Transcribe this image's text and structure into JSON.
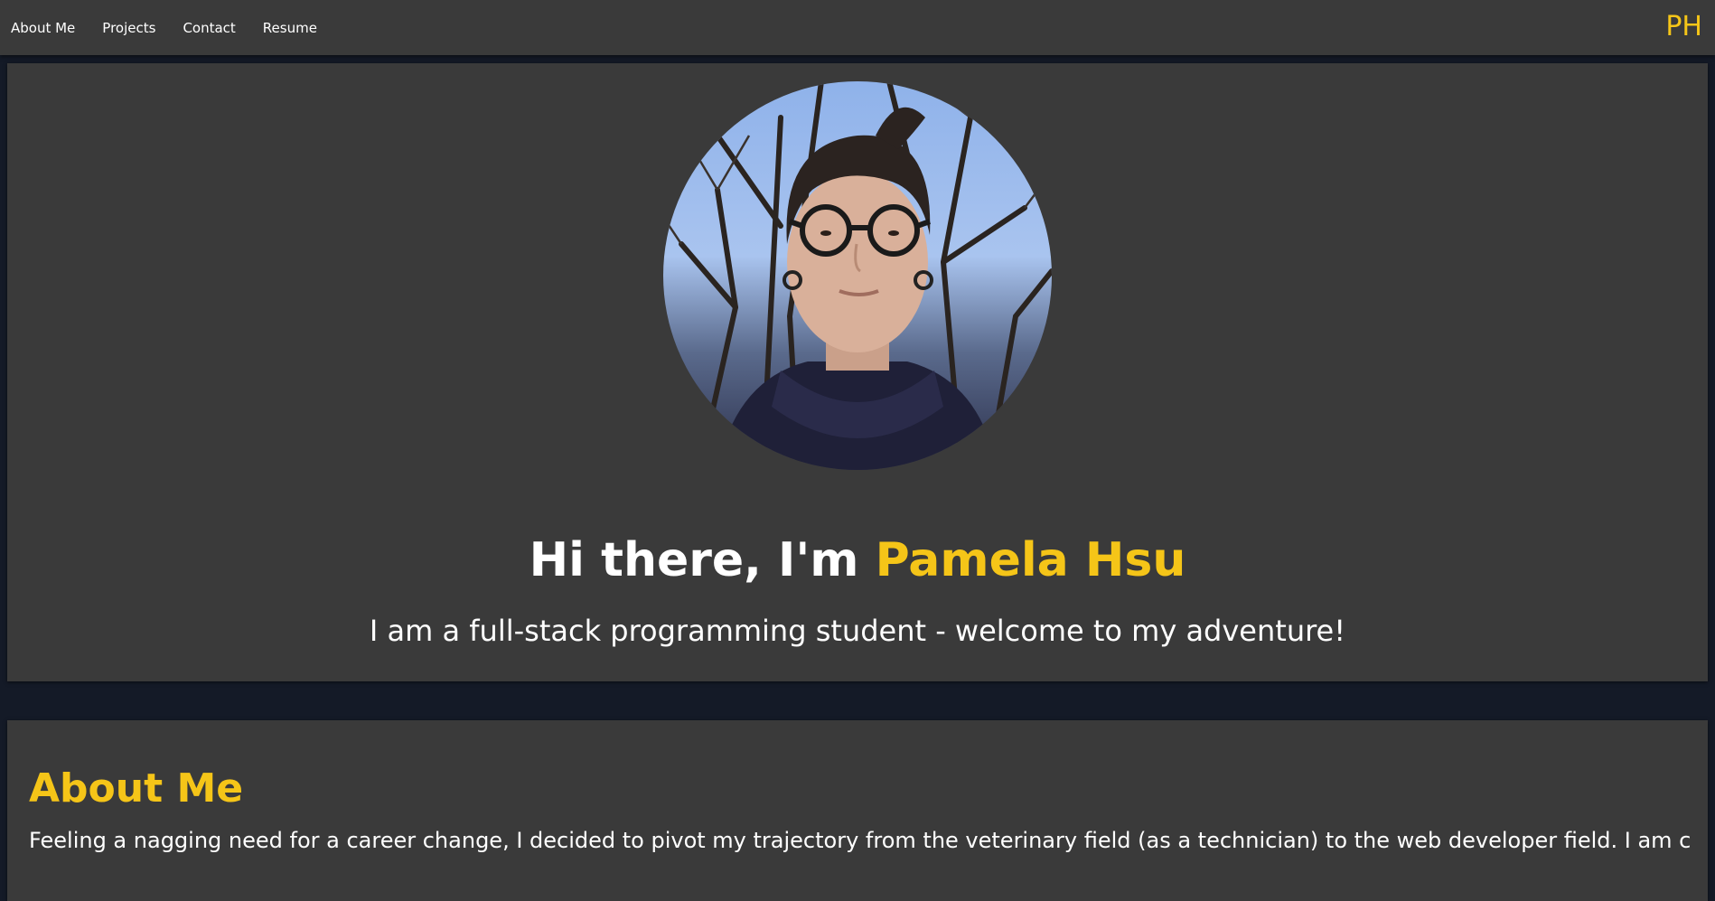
{
  "nav": {
    "links": [
      {
        "label": "About Me"
      },
      {
        "label": "Projects"
      },
      {
        "label": "Contact"
      },
      {
        "label": "Resume"
      }
    ],
    "brand": "PH"
  },
  "hero": {
    "greeting": "Hi there, I'm ",
    "name": "Pamela Hsu",
    "subtitle": "I am a full-stack programming student - welcome to my adventure!"
  },
  "about": {
    "heading": "About Me",
    "text": "Feeling a nagging need for a career change, I decided to pivot my trajectory from the veterinary field (as a technician) to the web developer field. I am currently"
  },
  "colors": {
    "accent": "#f5c518",
    "panel": "#3a3a3a",
    "background": "#141a27"
  }
}
